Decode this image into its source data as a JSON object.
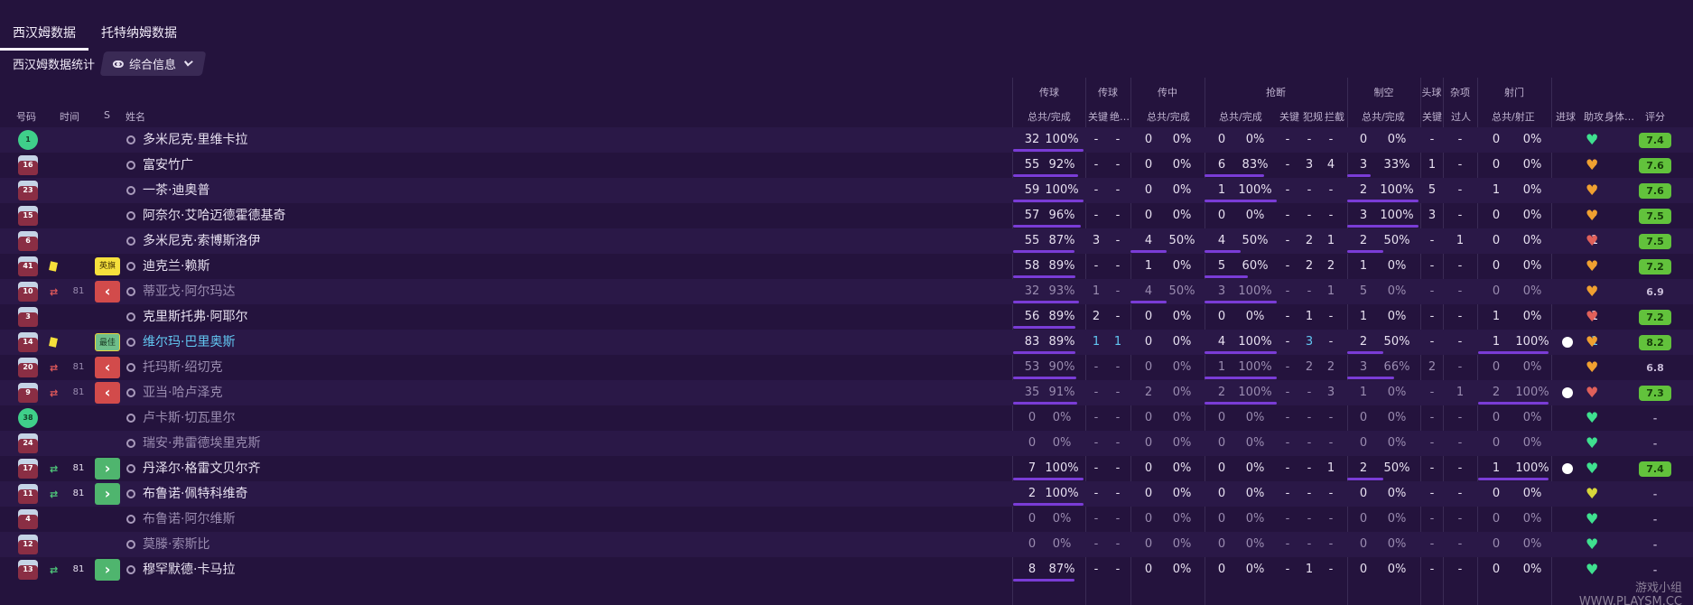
{
  "tabs": [
    {
      "label": "西汉姆数据",
      "active": true
    },
    {
      "label": "托特纳姆数据",
      "active": false
    }
  ],
  "subtitle": "西汉姆数据统计",
  "view_label": "综合信息",
  "groups": [
    {
      "key": "pass",
      "label": "传球"
    },
    {
      "key": "pass2",
      "label": "传球"
    },
    {
      "key": "cross",
      "label": "传中"
    },
    {
      "key": "tackle",
      "label": "抢断"
    },
    {
      "key": "air",
      "label": "制空"
    },
    {
      "key": "head",
      "label": "头球"
    },
    {
      "key": "misc",
      "label": "杂项"
    },
    {
      "key": "shot",
      "label": "射门"
    }
  ],
  "columns": {
    "num": "号码",
    "time": "时间",
    "s": "S",
    "name": "姓名",
    "pass_total": "总共/完成",
    "key": "关键",
    "assist_abbr": "绝…",
    "cross_total": "总共/完成",
    "tackle_total": "总共/完成",
    "tackle_key": "关键",
    "foul": "犯规",
    "intercept": "拦截",
    "air_total": "总共/完成",
    "head_key": "关键",
    "dribble": "过人",
    "shot_total": "总共/射正",
    "goals": "进球",
    "assists": "助攻",
    "body": "身体…",
    "rating": "评分"
  },
  "colors": {
    "bar": "#7a3cd6",
    "rating_green": "#62c23c",
    "sub_out": "#d24b4b",
    "sub_in": "#4fb56e"
  },
  "players": [
    {
      "no": "1",
      "gk": true,
      "name": "多米尼克·里维卡拉",
      "p": [
        "32",
        "100%"
      ],
      "pk": "-",
      "pa": "-",
      "cr": [
        "0",
        "0%"
      ],
      "tk": [
        "0",
        "0%"
      ],
      "tkk": "-",
      "fo": "-",
      "it": "-",
      "ai": [
        "0",
        "0%"
      ],
      "hd": "-",
      "dr": "-",
      "sh": [
        "0",
        "0%"
      ],
      "g": "",
      "a": "-",
      "heart": "green",
      "rt": "7.4"
    },
    {
      "no": "16",
      "name": "富安竹广",
      "p": [
        "55",
        "92%"
      ],
      "pk": "-",
      "pa": "-",
      "cr": [
        "0",
        "0%"
      ],
      "tk": [
        "6",
        "83%"
      ],
      "tkk": "-",
      "fo": "3",
      "it": "4",
      "ai": [
        "3",
        "33%"
      ],
      "hd": "1",
      "dr": "-",
      "sh": [
        "0",
        "0%"
      ],
      "g": "",
      "a": "-",
      "heart": "orange",
      "rt": "7.6"
    },
    {
      "no": "23",
      "name": "一茶·迪奥普",
      "p": [
        "59",
        "100%"
      ],
      "pk": "-",
      "pa": "-",
      "cr": [
        "0",
        "0%"
      ],
      "tk": [
        "1",
        "100%"
      ],
      "tkk": "-",
      "fo": "-",
      "it": "-",
      "ai": [
        "2",
        "100%"
      ],
      "hd": "5",
      "dr": "-",
      "sh": [
        "1",
        "0%"
      ],
      "g": "",
      "a": "-",
      "heart": "orange",
      "rt": "7.6"
    },
    {
      "no": "15",
      "name": "阿奈尔·艾哈迈德霍德基奇",
      "p": [
        "57",
        "96%"
      ],
      "pk": "-",
      "pa": "-",
      "cr": [
        "0",
        "0%"
      ],
      "tk": [
        "0",
        "0%"
      ],
      "tkk": "-",
      "fo": "-",
      "it": "-",
      "ai": [
        "3",
        "100%"
      ],
      "hd": "3",
      "dr": "-",
      "sh": [
        "0",
        "0%"
      ],
      "g": "",
      "a": "-",
      "heart": "orange",
      "rt": "7.5"
    },
    {
      "no": "6",
      "name": "多米尼克·索博斯洛伊",
      "p": [
        "55",
        "87%"
      ],
      "pk": "3",
      "pa": "-",
      "cr": [
        "4",
        "50%"
      ],
      "tk": [
        "4",
        "50%"
      ],
      "tkk": "-",
      "fo": "2",
      "it": "1",
      "ai": [
        "2",
        "50%"
      ],
      "hd": "-",
      "dr": "1",
      "sh": [
        "0",
        "0%"
      ],
      "g": "",
      "a": "1",
      "heart": "red",
      "rt": "7.5"
    },
    {
      "no": "41",
      "name": "迪克兰·赖斯",
      "card": true,
      "sbox": "badge",
      "sbox_text": "英旗",
      "p": [
        "58",
        "89%"
      ],
      "pk": "-",
      "pa": "-",
      "cr": [
        "1",
        "0%"
      ],
      "tk": [
        "5",
        "60%"
      ],
      "tkk": "-",
      "fo": "2",
      "it": "2",
      "ai": [
        "1",
        "0%"
      ],
      "hd": "-",
      "dr": "-",
      "sh": [
        "0",
        "0%"
      ],
      "g": "",
      "a": "-",
      "heart": "orange",
      "rt": "7.2"
    },
    {
      "no": "10",
      "name": "蒂亚戈·阿尔玛达",
      "sub": "out",
      "min": "81",
      "sbox": "red",
      "p": [
        "32",
        "93%"
      ],
      "pk": "1",
      "pa": "-",
      "cr": [
        "4",
        "50%"
      ],
      "tk": [
        "3",
        "100%"
      ],
      "tkk": "-",
      "fo": "-",
      "it": "1",
      "ai": [
        "5",
        "0%"
      ],
      "hd": "-",
      "dr": "-",
      "sh": [
        "0",
        "0%"
      ],
      "g": "",
      "a": "-",
      "heart": "orange",
      "rt": "6.9",
      "dim": true
    },
    {
      "no": "3",
      "name": "克里斯托弗·阿耶尔",
      "p": [
        "56",
        "89%"
      ],
      "pk": "2",
      "pa": "-",
      "cr": [
        "0",
        "0%"
      ],
      "tk": [
        "0",
        "0%"
      ],
      "tkk": "-",
      "fo": "1",
      "it": "-",
      "ai": [
        "1",
        "0%"
      ],
      "hd": "-",
      "dr": "-",
      "sh": [
        "1",
        "0%"
      ],
      "g": "",
      "a": "1",
      "heart": "red",
      "rt": "7.2"
    },
    {
      "no": "14",
      "name": "维尔玛·巴里奥斯",
      "card": true,
      "sbox": "best",
      "sbox_text": "最佳",
      "p": [
        "83",
        "89%"
      ],
      "pk": "1",
      "pa": "1",
      "cr": [
        "0",
        "0%"
      ],
      "tk": [
        "4",
        "100%"
      ],
      "tkk": "-",
      "fo": "3",
      "it": "-",
      "ai": [
        "2",
        "50%"
      ],
      "hd": "-",
      "dr": "-",
      "sh": [
        "1",
        "100%"
      ],
      "g": "ball",
      "a": "1",
      "heart": "orange",
      "rt": "8.2",
      "hl": true
    },
    {
      "no": "20",
      "name": "托玛斯·绍切克",
      "sub": "out",
      "min": "81",
      "sbox": "red",
      "p": [
        "53",
        "90%"
      ],
      "pk": "-",
      "pa": "-",
      "cr": [
        "0",
        "0%"
      ],
      "tk": [
        "1",
        "100%"
      ],
      "tkk": "-",
      "fo": "2",
      "it": "2",
      "ai": [
        "3",
        "66%"
      ],
      "hd": "2",
      "dr": "-",
      "sh": [
        "0",
        "0%"
      ],
      "g": "",
      "a": "-",
      "heart": "orange",
      "rt": "6.8",
      "dim": true
    },
    {
      "no": "9",
      "name": "亚当·哈卢泽克",
      "sub": "out",
      "min": "81",
      "sbox": "red",
      "p": [
        "35",
        "91%"
      ],
      "pk": "-",
      "pa": "-",
      "cr": [
        "2",
        "0%"
      ],
      "tk": [
        "2",
        "100%"
      ],
      "tkk": "-",
      "fo": "-",
      "it": "3",
      "ai": [
        "1",
        "0%"
      ],
      "hd": "-",
      "dr": "1",
      "sh": [
        "2",
        "100%"
      ],
      "g": "ball",
      "a": "-",
      "heart": "red",
      "rt": "7.3",
      "dim": true
    },
    {
      "no": "38",
      "gk": true,
      "name": "卢卡斯·切瓦里尔",
      "p": [
        "0",
        "0%"
      ],
      "pk": "-",
      "pa": "-",
      "cr": [
        "0",
        "0%"
      ],
      "tk": [
        "0",
        "0%"
      ],
      "tkk": "-",
      "fo": "-",
      "it": "-",
      "ai": [
        "0",
        "0%"
      ],
      "hd": "-",
      "dr": "-",
      "sh": [
        "0",
        "0%"
      ],
      "g": "",
      "a": "-",
      "heart": "green",
      "rt": "-",
      "dim": true
    },
    {
      "no": "24",
      "name": "瑞安·弗雷德埃里克斯",
      "p": [
        "0",
        "0%"
      ],
      "pk": "-",
      "pa": "-",
      "cr": [
        "0",
        "0%"
      ],
      "tk": [
        "0",
        "0%"
      ],
      "tkk": "-",
      "fo": "-",
      "it": "-",
      "ai": [
        "0",
        "0%"
      ],
      "hd": "-",
      "dr": "-",
      "sh": [
        "0",
        "0%"
      ],
      "g": "",
      "a": "-",
      "heart": "green",
      "rt": "-",
      "dim": true
    },
    {
      "no": "17",
      "name": "丹泽尔·格雷文贝尔齐",
      "sub": "in",
      "min": "81",
      "sbox": "green",
      "p": [
        "7",
        "100%"
      ],
      "pk": "-",
      "pa": "-",
      "cr": [
        "0",
        "0%"
      ],
      "tk": [
        "0",
        "0%"
      ],
      "tkk": "-",
      "fo": "-",
      "it": "1",
      "ai": [
        "2",
        "50%"
      ],
      "hd": "-",
      "dr": "-",
      "sh": [
        "1",
        "100%"
      ],
      "g": "ball",
      "a": "-",
      "heart": "green",
      "rt": "7.4"
    },
    {
      "no": "11",
      "name": "布鲁诺·佩特科维奇",
      "sub": "in",
      "min": "81",
      "sbox": "green",
      "p": [
        "2",
        "100%"
      ],
      "pk": "-",
      "pa": "-",
      "cr": [
        "0",
        "0%"
      ],
      "tk": [
        "0",
        "0%"
      ],
      "tkk": "-",
      "fo": "-",
      "it": "-",
      "ai": [
        "0",
        "0%"
      ],
      "hd": "-",
      "dr": "-",
      "sh": [
        "0",
        "0%"
      ],
      "g": "",
      "a": "-",
      "heart": "yellow",
      "rt": "-"
    },
    {
      "no": "4",
      "name": "布鲁诺·阿尔维斯",
      "p": [
        "0",
        "0%"
      ],
      "pk": "-",
      "pa": "-",
      "cr": [
        "0",
        "0%"
      ],
      "tk": [
        "0",
        "0%"
      ],
      "tkk": "-",
      "fo": "-",
      "it": "-",
      "ai": [
        "0",
        "0%"
      ],
      "hd": "-",
      "dr": "-",
      "sh": [
        "0",
        "0%"
      ],
      "g": "",
      "a": "-",
      "heart": "green",
      "rt": "-",
      "dim": true
    },
    {
      "no": "12",
      "name": "莫滕·索斯比",
      "p": [
        "0",
        "0%"
      ],
      "pk": "-",
      "pa": "-",
      "cr": [
        "0",
        "0%"
      ],
      "tk": [
        "0",
        "0%"
      ],
      "tkk": "-",
      "fo": "-",
      "it": "-",
      "ai": [
        "0",
        "0%"
      ],
      "hd": "-",
      "dr": "-",
      "sh": [
        "0",
        "0%"
      ],
      "g": "",
      "a": "-",
      "heart": "green",
      "rt": "-",
      "dim": true
    },
    {
      "no": "13",
      "name": "穆罕默德·卡马拉",
      "sub": "in",
      "min": "81",
      "sbox": "green",
      "p": [
        "8",
        "87%"
      ],
      "pk": "-",
      "pa": "-",
      "cr": [
        "0",
        "0%"
      ],
      "tk": [
        "0",
        "0%"
      ],
      "tkk": "-",
      "fo": "1",
      "it": "-",
      "ai": [
        "0",
        "0%"
      ],
      "hd": "-",
      "dr": "-",
      "sh": [
        "0",
        "0%"
      ],
      "g": "",
      "a": "-",
      "heart": "green",
      "rt": "-"
    }
  ],
  "watermark": "游戏小组 WWW.PLAYSM.CC"
}
